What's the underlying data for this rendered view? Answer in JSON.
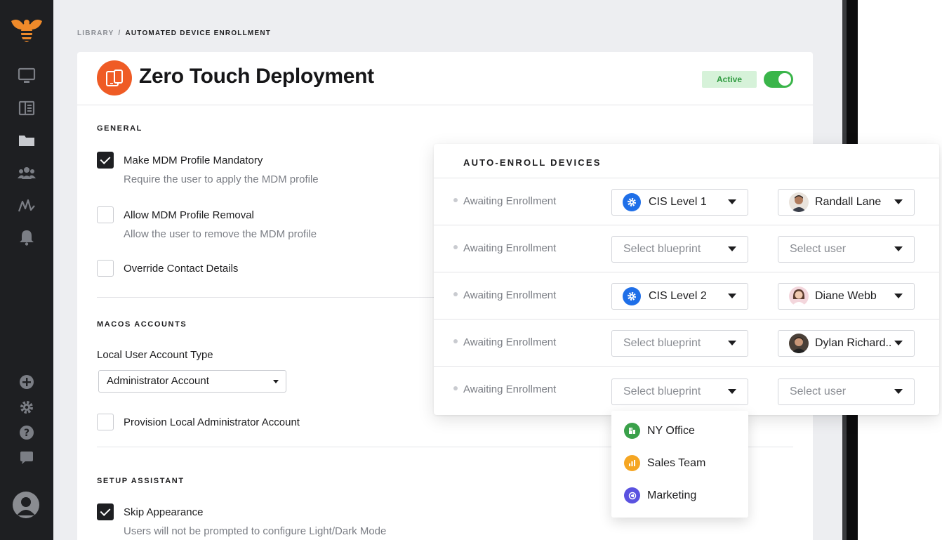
{
  "breadcrumb": {
    "root": "LIBRARY",
    "separator": "/",
    "current": "AUTOMATED DEVICE ENROLLMENT"
  },
  "header": {
    "title": "Zero Touch Deployment",
    "status_badge": "Active",
    "enabled": true
  },
  "colors": {
    "accent": "#ef5b25",
    "active_green": "#3ab54a",
    "sidebar": "#1e1f22",
    "blueprint_blue": "#1f6fe8"
  },
  "sidebar": {
    "top_icons": [
      "computer-icon",
      "library-icon",
      "folder-icon",
      "users-icon",
      "activity-icon",
      "bell-icon"
    ],
    "bottom_icons": [
      "add-icon",
      "settings-icon",
      "help-icon",
      "chat-icon",
      "user-avatar"
    ]
  },
  "general": {
    "title": "GENERAL",
    "options": [
      {
        "label": "Make MDM Profile Mandatory",
        "description": "Require the user to apply the MDM profile",
        "checked": true
      },
      {
        "label": "Allow MDM Profile Removal",
        "description": "Allow the user to remove the MDM profile",
        "checked": false
      },
      {
        "label": "Override Contact Details",
        "description": "",
        "checked": false
      }
    ]
  },
  "macos_accounts": {
    "title": "MACOS ACCOUNTS",
    "field_label": "Local User Account Type",
    "selected": "Administrator Account",
    "provision": {
      "label": "Provision Local Administrator Account",
      "checked": false
    }
  },
  "setup_assistant": {
    "title": "SETUP ASSISTANT",
    "options": [
      {
        "label": "Skip Appearance",
        "description": "Users will not be prompted to configure Light/Dark Mode",
        "checked": true
      }
    ]
  },
  "auto_enroll": {
    "title": "AUTO-ENROLL DEVICES",
    "blueprint_placeholder": "Select blueprint",
    "user_placeholder": "Select user",
    "rows": [
      {
        "status": "Awaiting Enrollment",
        "blueprint": "CIS Level 1",
        "user": "Randall Lane"
      },
      {
        "status": "Awaiting Enrollment",
        "blueprint": "",
        "user": ""
      },
      {
        "status": "Awaiting Enrollment",
        "blueprint": "CIS Level 2",
        "user": "Diane Webb"
      },
      {
        "status": "Awaiting Enrollment",
        "blueprint": "",
        "user": "Dylan Richard.."
      },
      {
        "status": "Awaiting Enrollment",
        "blueprint": "",
        "user": ""
      }
    ],
    "blueprint_menu": [
      {
        "label": "NY Office",
        "color": "#3aa14a",
        "icon": "building-icon"
      },
      {
        "label": "Sales Team",
        "color": "#f5a623",
        "icon": "chart-icon"
      },
      {
        "label": "Marketing",
        "color": "#5a52e0",
        "icon": "megaphone-icon"
      }
    ]
  }
}
